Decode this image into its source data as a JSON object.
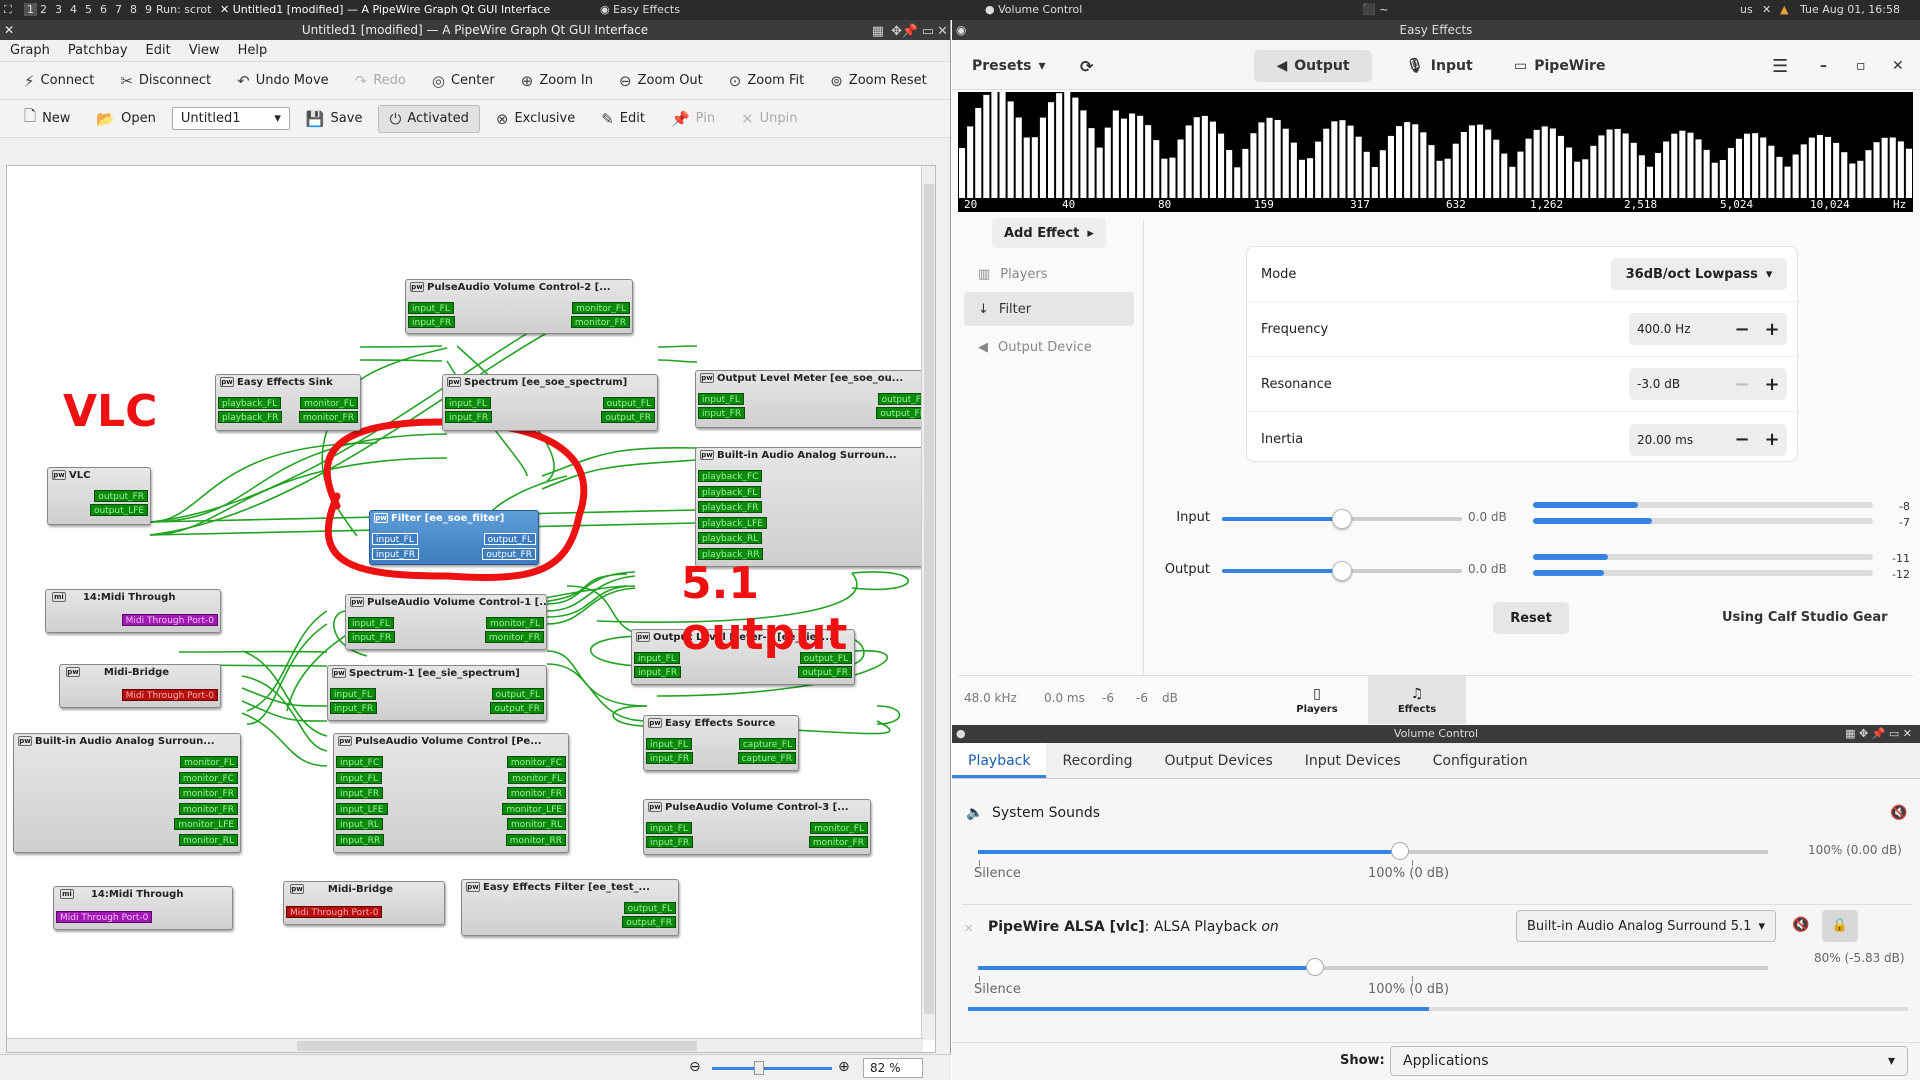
{
  "taskbar": {
    "workspaces": [
      "1",
      "2",
      "3",
      "4",
      "5",
      "6",
      "7",
      "8",
      "9"
    ],
    "run_label": "Run: scrot",
    "qpw_task": "Untitled1 [modified] — A PipeWire Graph Qt GUI Interface",
    "ee_task": "Easy Effects",
    "vc_task": "Volume Control",
    "term_task": "~",
    "kb_layout": "us",
    "clock": "Tue Aug 01, 16:58"
  },
  "qpw": {
    "title": "Untitled1 [modified] — A PipeWire Graph Qt GUI Interface",
    "menu": [
      "Graph",
      "Patchbay",
      "Edit",
      "View",
      "Help"
    ],
    "toolbar1": {
      "connect": "Connect",
      "disconnect": "Disconnect",
      "undo": "Undo Move",
      "redo": "Redo",
      "center": "Center",
      "zoom_in": "Zoom In",
      "zoom_out": "Zoom Out",
      "zoom_fit": "Zoom Fit",
      "zoom_reset": "Zoom Reset",
      "more": "»"
    },
    "toolbar2": {
      "new": "New",
      "open": "Open",
      "patchbay": "Untitled1",
      "save": "Save",
      "activated": "Activated",
      "exclusive": "Exclusive",
      "edit": "Edit",
      "pin": "Pin",
      "unpin": "Unpin"
    },
    "annotations": {
      "vlc": "VLC",
      "output51": "5.1 output"
    },
    "zoom": "82 %",
    "nodes": {
      "pavc2": {
        "title": "PulseAudio Volume Control-2 [...",
        "ports": [
          "input_FL",
          "input_FR",
          "monitor_FL",
          "monitor_FR"
        ]
      },
      "sink": {
        "title": "Easy Effects Sink",
        "ports": [
          "playback_FL",
          "playback_FR",
          "monitor_FL",
          "monitor_FR"
        ]
      },
      "spectrum": {
        "title": "Spectrum [ee_soe_spectrum]",
        "ports": [
          "input_FL",
          "input_FR",
          "output_FL",
          "output_FR"
        ]
      },
      "olm": {
        "title": "Output Level Meter [ee_soe_ou...",
        "ports": [
          "input_FL",
          "input_FR",
          "output_FL",
          "output_FR"
        ]
      },
      "vlc": {
        "title": "VLC",
        "ports": [
          "output_FR",
          "output_LFE"
        ]
      },
      "builtin1": {
        "title": "Built-in Audio Analog Surroun...",
        "ports": [
          "playback_FC",
          "playback_FL",
          "playback_FR",
          "playback_LFE",
          "playback_RL",
          "playback_RR"
        ]
      },
      "filter": {
        "title": "Filter [ee_soe_filter]",
        "ports": [
          "input_FL",
          "input_FR",
          "output_FL",
          "output_FR"
        ]
      },
      "midi1": {
        "title": "14:Midi Through",
        "ports": [
          "Midi Through Port-0"
        ]
      },
      "pavc1": {
        "title": "PulseAudio Volume Control-1 [...",
        "ports": [
          "input_FL",
          "input_FR",
          "monitor_FL",
          "monitor_FR"
        ]
      },
      "olm1": {
        "title": "Output Level Meter-1 [ee_sie_...",
        "ports": [
          "input_FL",
          "input_FR",
          "output_FL",
          "output_FR"
        ]
      },
      "midibridge1": {
        "title": "Midi-Bridge",
        "ports": [
          "Midi Through Port-0"
        ]
      },
      "spectrum1": {
        "title": "Spectrum-1 [ee_sie_spectrum]",
        "ports": [
          "input_FL",
          "input_FR",
          "output_FL",
          "output_FR"
        ]
      },
      "builtin2": {
        "title": "Built-in Audio Analog Surroun...",
        "ports": [
          "monitor_FL",
          "monitor_FC",
          "monitor_FR",
          "monitor_FR",
          "monitor_LFE",
          "monitor_RL"
        ]
      },
      "eesource": {
        "title": "Easy Effects Source",
        "ports": [
          "input_FL",
          "input_FR",
          "capture_FL",
          "capture_FR"
        ]
      },
      "pavcpe": {
        "title": "PulseAudio Volume Control [Pe...",
        "ports": [
          "input_FC",
          "input_FL",
          "input_FR",
          "input_LFE",
          "input_RL",
          "input_RR",
          "monitor_FC",
          "monitor_FL",
          "monitor_FR",
          "monitor_LFE",
          "monitor_RL",
          "monitor_RR"
        ]
      },
      "pavc3": {
        "title": "PulseAudio Volume Control-3 [...",
        "ports": [
          "input_FL",
          "input_FR",
          "monitor_FL",
          "monitor_FR"
        ]
      },
      "midi2": {
        "title": "14:Midi Through",
        "ports": [
          "Midi Through Port-0"
        ]
      },
      "midibridge2": {
        "title": "Midi-Bridge",
        "ports": [
          "Midi Through Port-0"
        ]
      },
      "eefilter": {
        "title": "Easy Effects Filter [ee_test_...",
        "ports": [
          "output_FL",
          "output_FR"
        ]
      }
    }
  },
  "ee": {
    "title": "Easy Effects",
    "presets": "Presets",
    "tabs": [
      "Output",
      "Input",
      "PipeWire"
    ],
    "freq_labels": [
      "20",
      "40",
      "80",
      "159",
      "317",
      "632",
      "1,262",
      "2,518",
      "5,024",
      "10,024",
      "Hz"
    ],
    "add_effect": "Add Effect",
    "side": [
      "Players",
      "Filter",
      "Output Device"
    ],
    "mode_label": "Mode",
    "mode_value": "36dB/oct Lowpass",
    "frequency_label": "Frequency",
    "frequency_value": "400.0 Hz",
    "resonance_label": "Resonance",
    "resonance_value": "-3.0 dB",
    "inertia_label": "Inertia",
    "inertia_value": "20.00 ms",
    "input_label": "Input",
    "input_db": "0.0 dB",
    "input_levels": [
      "-8",
      "-7"
    ],
    "output_label": "Output",
    "output_db": "0.0 dB",
    "output_levels": [
      "-11",
      "-12"
    ],
    "input_slider_fraction": 0.5,
    "output_slider_fraction": 0.5,
    "input_meter_fractions": [
      0.31,
      0.35
    ],
    "output_meter_fractions": [
      0.22,
      0.21
    ],
    "reset": "Reset",
    "calf": "Using Calf Studio Gear",
    "status": {
      "rate": "48.0 kHz",
      "latency": "0.0 ms",
      "peak_l": "-6",
      "peak_r": "-6",
      "unit": "dB"
    },
    "bottom_tabs": [
      "Players",
      "Effects"
    ]
  },
  "vc": {
    "title": "Volume Control",
    "tabs": [
      "Playback",
      "Recording",
      "Output Devices",
      "Input Devices",
      "Configuration"
    ],
    "system_sounds": "System Sounds",
    "sys_pct": "100% (0.00 dB)",
    "sys_fraction": 1.0,
    "silence": "Silence",
    "hundred": "100% (0 dB)",
    "stream_name": "PipeWire ALSA [vlc]",
    "stream_desc": ": ALSA Playback",
    "stream_on": "on",
    "stream_device": "Built-in Audio Analog Surround 5.1",
    "stream_pct": "80% (-5.83 dB)",
    "stream_fraction": 0.8,
    "stream_level_fraction": 0.49,
    "show_label": "Show:",
    "show_value": "Applications"
  }
}
